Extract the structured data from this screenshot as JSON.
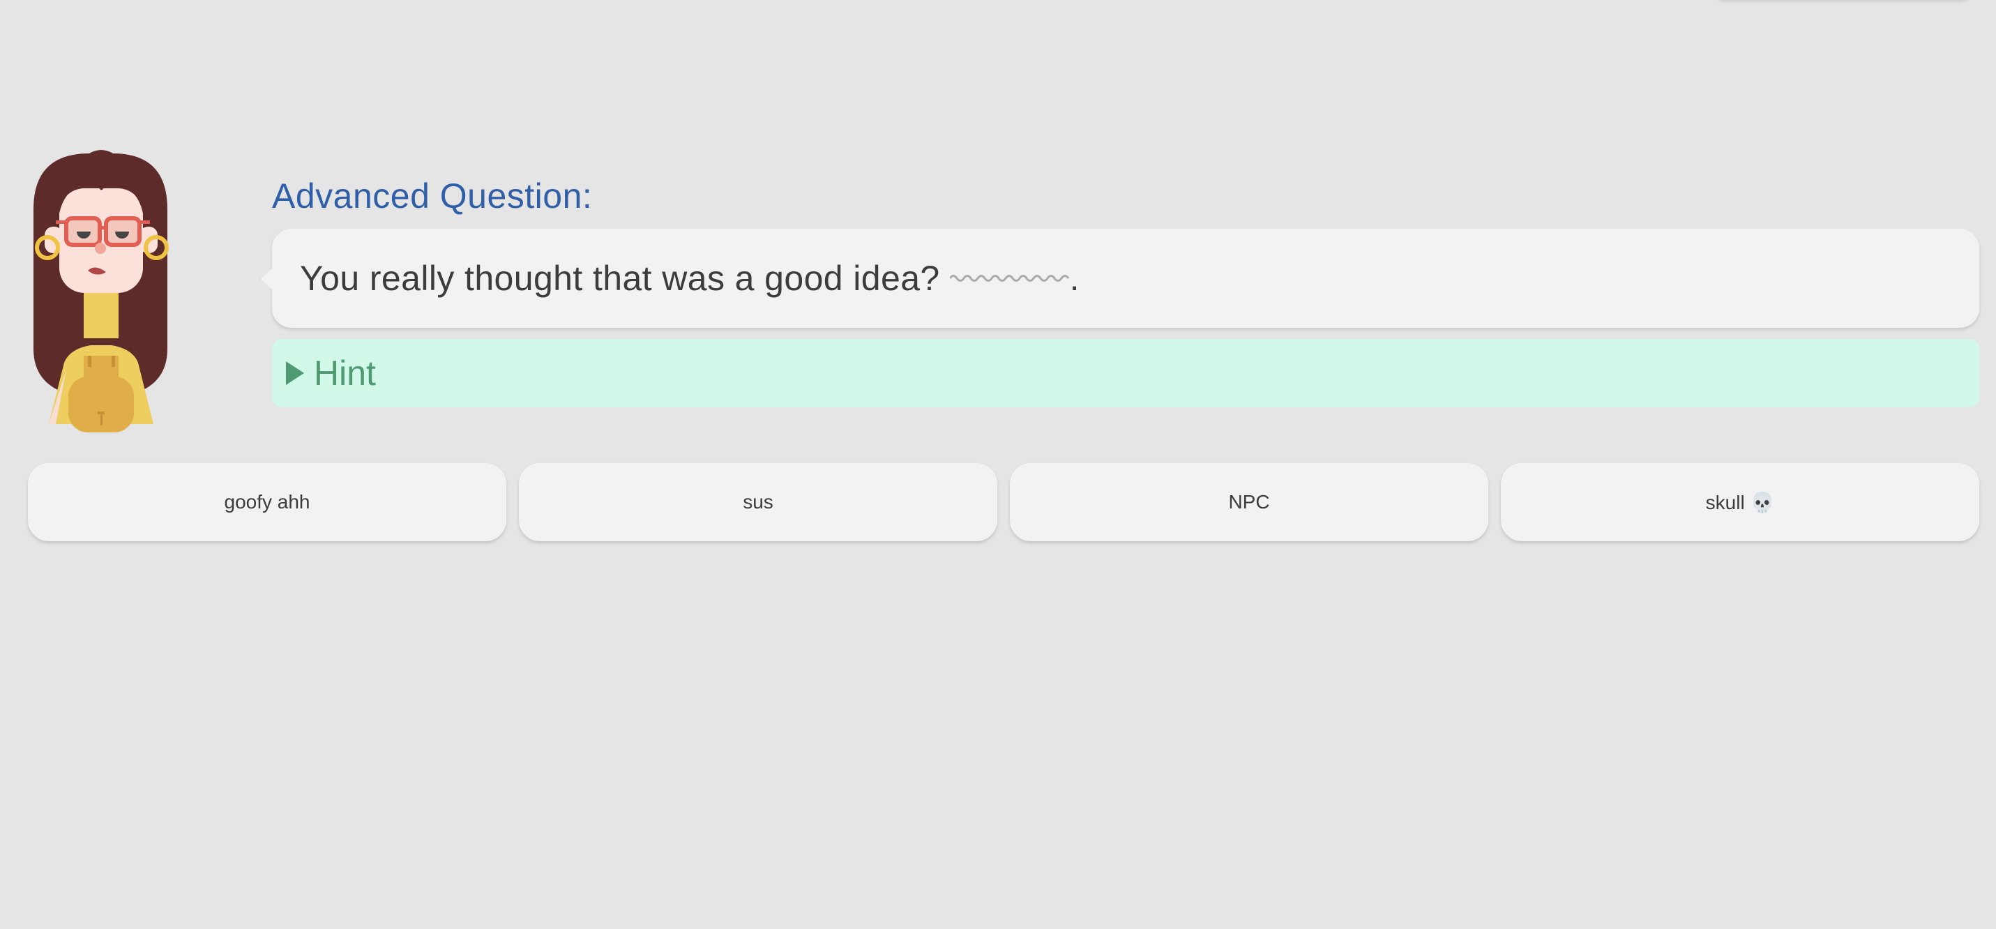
{
  "question": {
    "label": "Advanced Question:",
    "text": "You really thought that was a good idea?",
    "blank_end": "."
  },
  "hint": {
    "label": "Hint"
  },
  "answers": [
    {
      "label": "goofy ahh"
    },
    {
      "label": "sus"
    },
    {
      "label": "NPC"
    },
    {
      "label": "skull 💀"
    }
  ],
  "icons": {
    "character": "woman-with-glasses-avatar",
    "hint_toggle": "triangle-right-icon",
    "blank": "wavy-underline-blank"
  },
  "colors": {
    "background": "#e5e5e5",
    "question_label": "#2f5fa8",
    "hint_background": "#d1f8e8",
    "hint_text": "#4f9a72",
    "card": "#f2f2f2"
  }
}
